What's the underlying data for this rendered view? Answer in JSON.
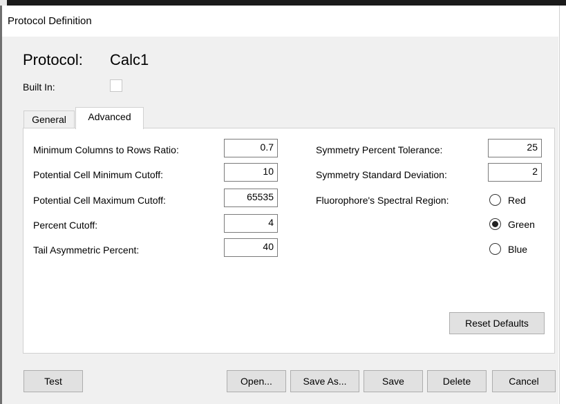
{
  "window": {
    "title": "Protocol Definition"
  },
  "protocol": {
    "label": "Protocol:",
    "value": "Calc1"
  },
  "built_in": {
    "label": "Built In:",
    "checked": false
  },
  "tabs": [
    {
      "label": "General",
      "selected": false
    },
    {
      "label": "Advanced",
      "selected": true
    }
  ],
  "advanced": {
    "left_fields": [
      {
        "label": "Minimum Columns to Rows Ratio:",
        "value": "0.7"
      },
      {
        "label": "Potential Cell Minimum Cutoff:",
        "value": "10"
      },
      {
        "label": "Potential Cell Maximum Cutoff:",
        "value": "65535"
      },
      {
        "label": "Percent Cutoff:",
        "value": "4"
      },
      {
        "label": "Tail Asymmetric Percent:",
        "value": "40"
      }
    ],
    "right_fields": [
      {
        "label": "Symmetry Percent Tolerance:",
        "value": "25"
      },
      {
        "label": "Symmetry Standard Deviation:",
        "value": "2"
      }
    ],
    "spectral_region": {
      "label": "Fluorophore's Spectral Region:",
      "options": [
        "Red",
        "Green",
        "Blue"
      ],
      "selected": "Green"
    },
    "reset_label": "Reset Defaults"
  },
  "buttons": {
    "test": "Test",
    "open": "Open...",
    "save_as": "Save As...",
    "save": "Save",
    "delete": "Delete",
    "cancel": "Cancel"
  }
}
